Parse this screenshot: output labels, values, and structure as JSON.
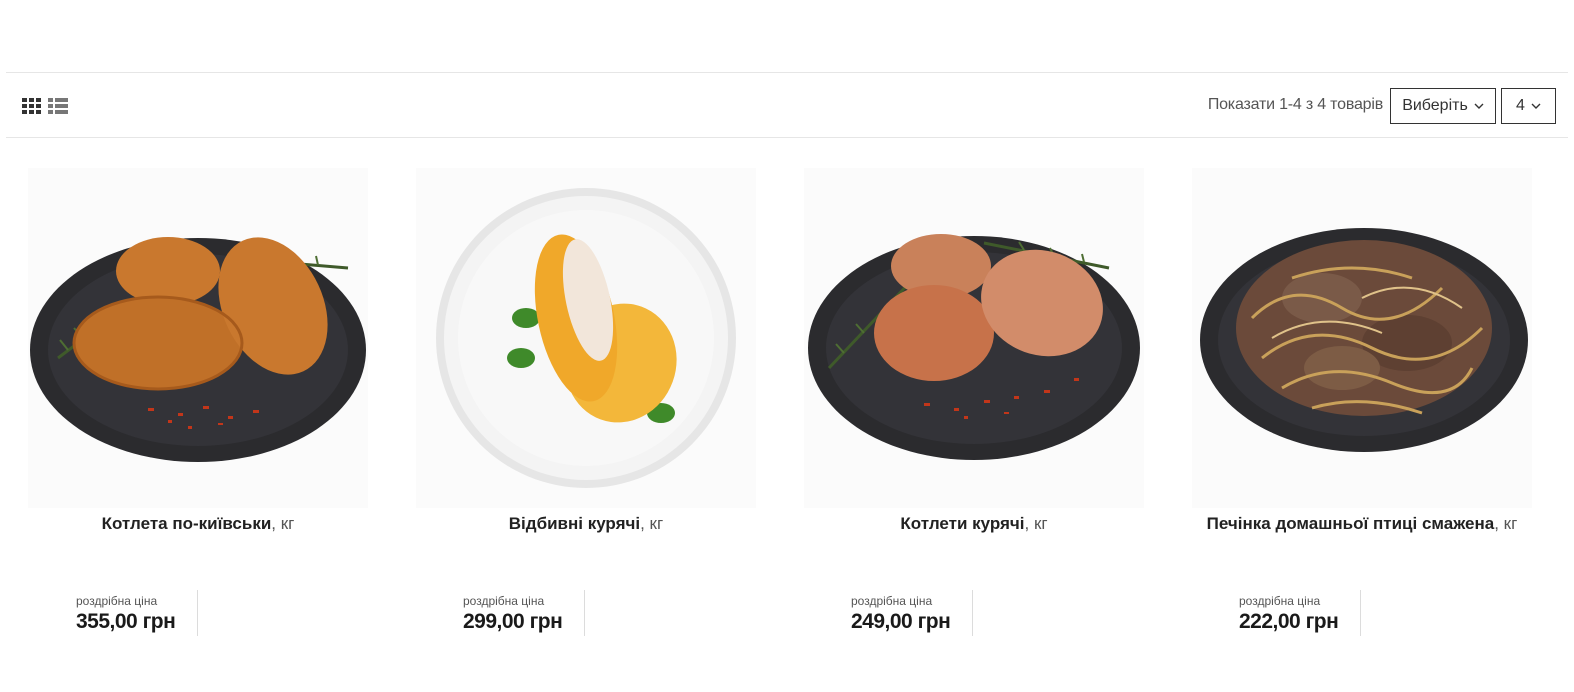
{
  "toolbar": {
    "grid_view_icon": "grid-icon",
    "list_view_icon": "list-icon",
    "count_text": "Показати 1-4 з 4 товарів",
    "sort_select": {
      "selected": "Виберіть"
    },
    "perpage_select": {
      "selected": "4"
    }
  },
  "products": [
    {
      "name": "Котлета по-київськи",
      "unit": ", кг",
      "price_label": "роздрібна ціна",
      "price": "355,00 грн",
      "plate": "dark",
      "food": "kyiv-cutlets"
    },
    {
      "name": "Відбивні курячі",
      "unit": ", кг",
      "price_label": "роздрібна ціна",
      "price": "299,00 грн",
      "plate": "white",
      "food": "chicken-chops"
    },
    {
      "name": "Котлети курячі",
      "unit": ", кг",
      "price_label": "роздрібна ціна",
      "price": "249,00 грн",
      "plate": "dark",
      "food": "chicken-cutlets"
    },
    {
      "name": "Печінка домашньої птиці смажена",
      "unit": ", кг",
      "price_label": "роздрібна ціна",
      "price": "222,00 грн",
      "plate": "dark",
      "food": "fried-liver"
    }
  ],
  "colors": {
    "plate_dark": "#2b2b2e",
    "plate_white": "#f4f4f4",
    "crust": "#c9782e",
    "crust_dark": "#a65a1c",
    "rosemary": "#3f5a2a",
    "chili": "#c2361a",
    "egg": "#f3b73a",
    "meat_pale": "#f2e6da",
    "basil": "#3f8a2a",
    "liver": "#6b4a3a",
    "onion": "#c9a15a"
  }
}
